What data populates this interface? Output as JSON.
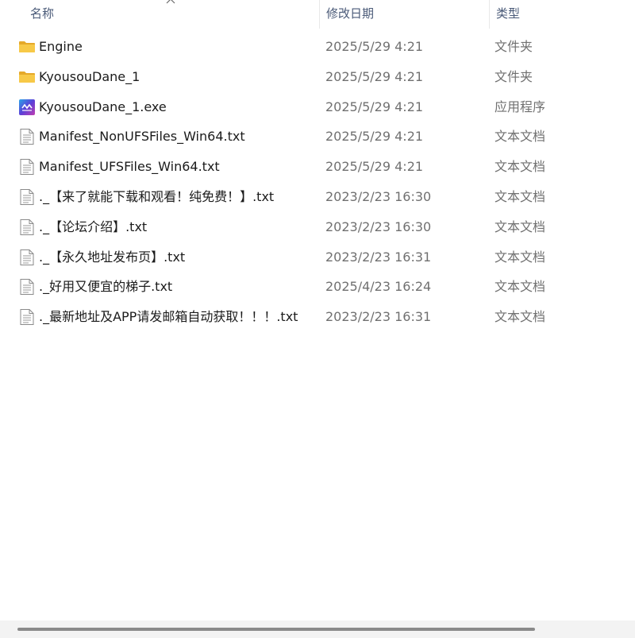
{
  "columns": {
    "name": "名称",
    "date": "修改日期",
    "type": "类型"
  },
  "files": [
    {
      "name": "Engine",
      "date": "2025/5/29 4:21",
      "type": "文件夹",
      "icon": "folder-icon"
    },
    {
      "name": "KyousouDane_1",
      "date": "2025/5/29 4:21",
      "type": "文件夹",
      "icon": "folder-icon"
    },
    {
      "name": "KyousouDane_1.exe",
      "date": "2025/5/29 4:21",
      "type": "应用程序",
      "icon": "application-icon"
    },
    {
      "name": "Manifest_NonUFSFiles_Win64.txt",
      "date": "2025/5/29 4:21",
      "type": "文本文档",
      "icon": "text-file-icon"
    },
    {
      "name": "Manifest_UFSFiles_Win64.txt",
      "date": "2025/5/29 4:21",
      "type": "文本文档",
      "icon": "text-file-icon"
    },
    {
      "name": "._【来了就能下载和观看！纯免费！】.txt",
      "date": "2023/2/23 16:30",
      "type": "文本文档",
      "icon": "text-file-icon"
    },
    {
      "name": "._【论坛介绍】.txt",
      "date": "2023/2/23 16:30",
      "type": "文本文档",
      "icon": "text-file-icon"
    },
    {
      "name": "._【永久地址发布页】.txt",
      "date": "2023/2/23 16:31",
      "type": "文本文档",
      "icon": "text-file-icon"
    },
    {
      "name": "._好用又便宜的梯子.txt",
      "date": "2025/4/23 16:24",
      "type": "文本文档",
      "icon": "text-file-icon"
    },
    {
      "name": "._最新地址及APP请发邮箱自动获取！！！.txt",
      "date": "2023/2/23 16:31",
      "type": "文本文档",
      "icon": "text-file-icon"
    }
  ],
  "colors": {
    "folder": "#f7c948",
    "folder_dark": "#e5a92a",
    "app_bg": "#5b3fd8",
    "header_text": "#4a5a78",
    "secondary_text": "#707070"
  }
}
